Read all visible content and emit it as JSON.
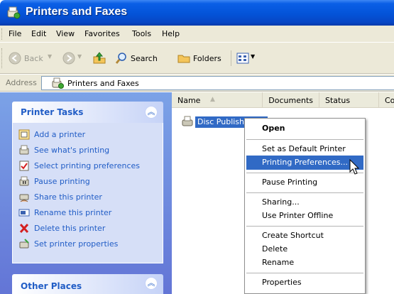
{
  "window": {
    "title": "Printers and Faxes"
  },
  "menu": [
    "File",
    "Edit",
    "View",
    "Favorites",
    "Tools",
    "Help"
  ],
  "toolbar": {
    "back": "Back",
    "search": "Search",
    "folders": "Folders"
  },
  "address": {
    "label": "Address",
    "value": "Printers and Faxes"
  },
  "left_pane": {
    "tasks_title": "Printer Tasks",
    "tasks": [
      {
        "label": "Add a printer",
        "icon": "add-printer-icon"
      },
      {
        "label": "See what's printing",
        "icon": "print-queue-icon"
      },
      {
        "label": "Select printing preferences",
        "icon": "preferences-check-icon"
      },
      {
        "label": "Pause printing",
        "icon": "pause-printer-icon"
      },
      {
        "label": "Share this printer",
        "icon": "share-printer-icon"
      },
      {
        "label": "Rename this printer",
        "icon": "rename-icon"
      },
      {
        "label": "Delete this printer",
        "icon": "delete-x-icon"
      },
      {
        "label": "Set printer properties",
        "icon": "properties-icon"
      }
    ],
    "other_title": "Other Places"
  },
  "list": {
    "columns": [
      "Name",
      "Documents",
      "Status",
      "Co"
    ],
    "items": [
      {
        "name": "Disc Publisher XR"
      }
    ]
  },
  "context_menu": {
    "items": [
      "Open",
      "Set as Default Printer",
      "Printing Preferences...",
      "Pause Printing",
      "Sharing...",
      "Use Printer Offline",
      "Create Shortcut",
      "Delete",
      "Rename",
      "Properties"
    ],
    "highlighted": "Printing Preferences..."
  },
  "colors": {
    "titlebar": "#0453d8",
    "accent": "#316ac5",
    "task_link": "#215dc6",
    "pane_bg": "#7ba2e7"
  }
}
